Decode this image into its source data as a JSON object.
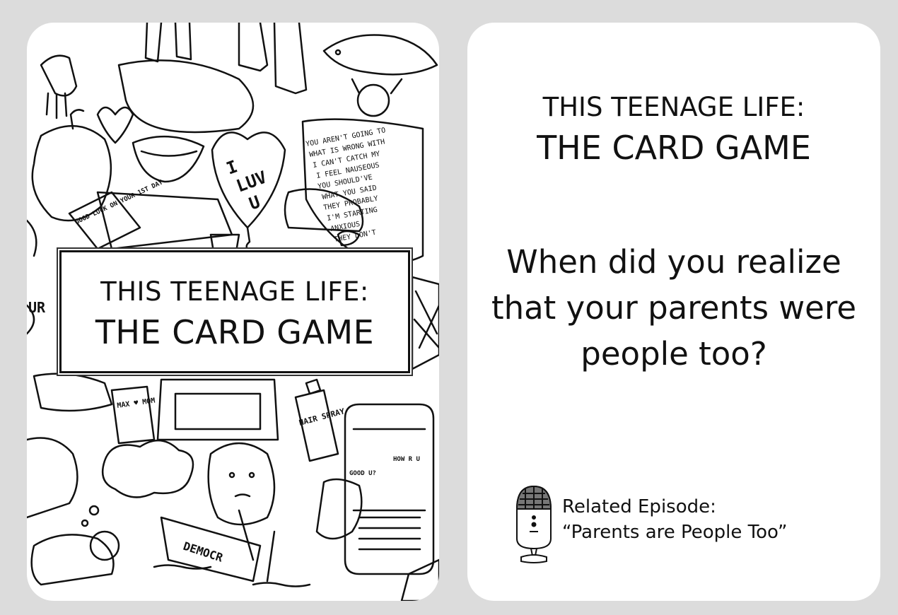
{
  "front_card": {
    "title_line1": "THIS TEENAGE LIFE:",
    "title_line2": "THE CARD GAME",
    "doodle_labels": [
      "I",
      "LUV",
      "U",
      "GOOD LUCK ON YOUR 1ST DAY",
      "MAX ♥ MOM",
      "HAIR SPRAY",
      "HOW R U",
      "GOOD U?",
      "DEMOCR",
      "UR"
    ]
  },
  "back_card": {
    "title_line1": "THIS TEENAGE LIFE:",
    "title_line2": "THE CARD GAME",
    "question": "When did you realize that your parents were people too?",
    "episode_label": "Related Episode:",
    "episode_title": "“Parents are People Too”",
    "icon": "microphone-icon"
  }
}
